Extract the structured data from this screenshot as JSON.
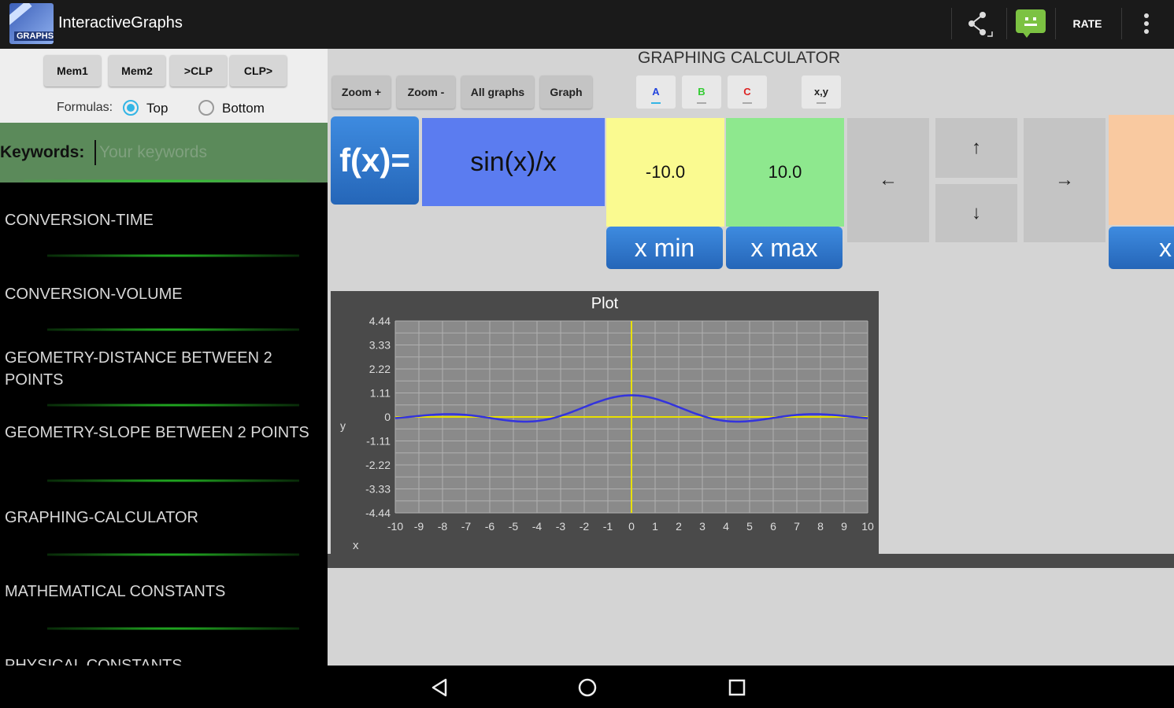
{
  "app": {
    "title": "InteractiveGraphs",
    "icon_label": "GRAPHS"
  },
  "actionbar": {
    "share_icon": "share-icon",
    "chat_icon": "android-chat-icon",
    "rate_label": "RATE",
    "overflow_icon": "overflow-menu-icon"
  },
  "left": {
    "mem_buttons": [
      "Mem1",
      "Mem2",
      ">CLP",
      "CLP>"
    ],
    "formulas_label": "Formulas:",
    "radio_top": "Top",
    "radio_bottom": "Bottom",
    "formulas_selected": "Top",
    "keywords_label": "Keywords:",
    "keywords_placeholder": "Your keywords",
    "items": [
      "CONVERSION-TIME",
      "CONVERSION-VOLUME",
      "GEOMETRY-DISTANCE BETWEEN 2 POINTS",
      "GEOMETRY-SLOPE BETWEEN 2 POINTS",
      "GRAPHING-CALCULATOR",
      "MATHEMATICAL CONSTANTS",
      "PHYSICAL CONSTANTS"
    ]
  },
  "calc": {
    "title": "GRAPHING CALCULATOR",
    "tools": [
      "Zoom +",
      "Zoom -",
      "All graphs",
      "Graph"
    ],
    "color_buttons": [
      {
        "label": "A",
        "color": "#2244dd"
      },
      {
        "label": "B",
        "color": "#33cc33"
      },
      {
        "label": "C",
        "color": "#dd2222"
      }
    ],
    "xy_label": "x,y",
    "fx_label": "f(x)=",
    "fx_value": "sin(x)/x",
    "xmin_value": "-10.0",
    "xmax_value": "10.0",
    "xmin_label": "x min",
    "xmax_label": "x max",
    "partial_label": "x",
    "arrows": {
      "left": "←",
      "up": "↑",
      "down": "↓",
      "right": "→"
    }
  },
  "colors": {
    "peach": "#f9c9a0",
    "fx_input": "#5b7cf0",
    "xmin_bg": "#fafa90",
    "xmax_bg": "#8ee88e"
  },
  "chart_data": {
    "type": "line",
    "title": "Plot",
    "xlabel": "x",
    "ylabel": "y",
    "xlim": [
      -10,
      10
    ],
    "ylim": [
      -4.44,
      4.44
    ],
    "x_ticks": [
      "-10",
      "-9",
      "-8",
      "-7",
      "-6",
      "-5",
      "-4",
      "-3",
      "-2",
      "-1",
      "0",
      "1",
      "2",
      "3",
      "4",
      "5",
      "6",
      "7",
      "8",
      "9",
      "10"
    ],
    "y_ticks": [
      "4.44",
      "3.33",
      "2.22",
      "1.11",
      "0",
      "-1.11",
      "-2.22",
      "-3.33",
      "-4.44"
    ],
    "grid": true,
    "series": [
      {
        "function": "sin(x)/x",
        "color": "#3333dd"
      }
    ],
    "axis_color": "#e8e000"
  },
  "navbar": {
    "back_icon": "back-icon",
    "home_icon": "home-icon",
    "recents_icon": "recents-icon"
  }
}
